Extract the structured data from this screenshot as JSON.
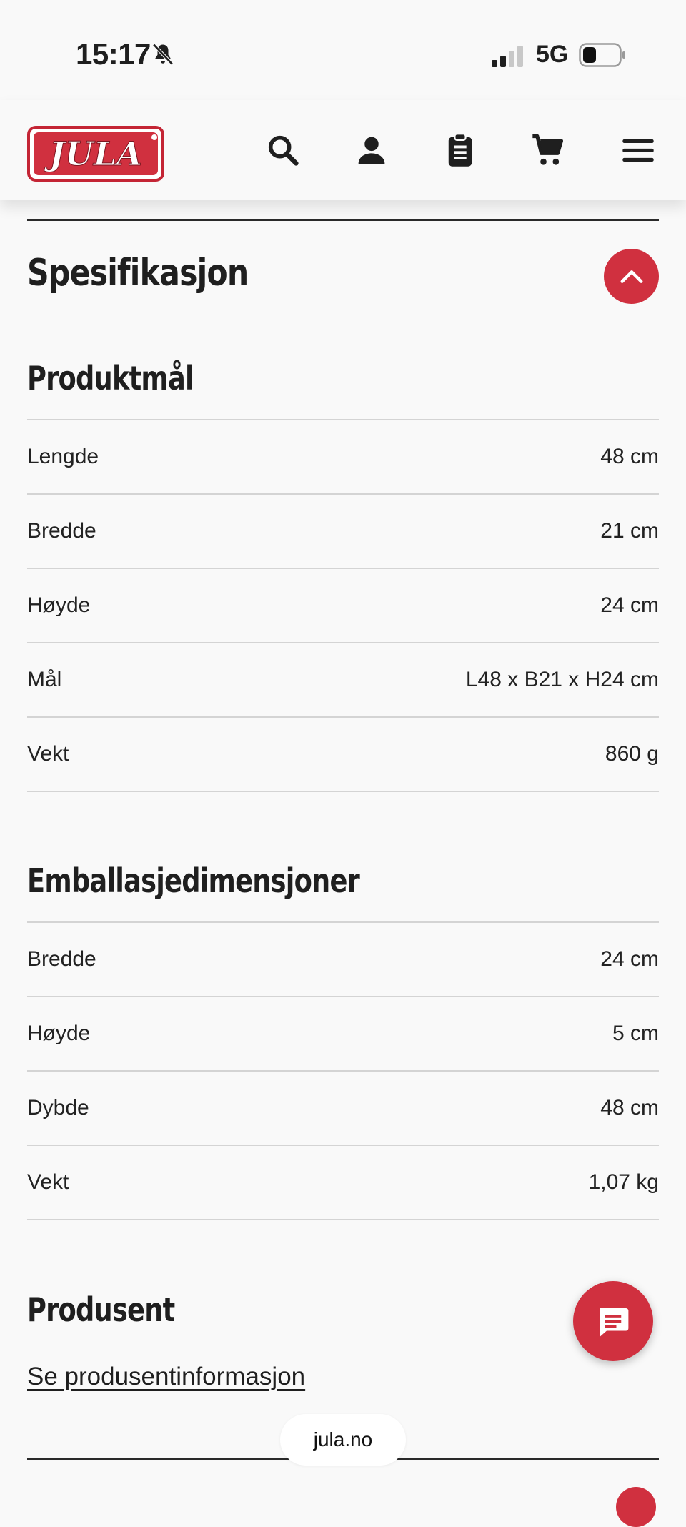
{
  "status_bar": {
    "time": "15:17",
    "network": "5G"
  },
  "header": {
    "logo_text": "JULA",
    "icons": [
      "search-icon",
      "account-icon",
      "clipboard-icon",
      "cart-icon",
      "menu-icon"
    ],
    "brand_color": "#d0303f"
  },
  "spec": {
    "title": "Spesifikasjon",
    "product_dimensions": {
      "title": "Produktmål",
      "rows": [
        {
          "label": "Lengde",
          "value": "48 cm"
        },
        {
          "label": "Bredde",
          "value": "21 cm"
        },
        {
          "label": "Høyde",
          "value": "24 cm"
        },
        {
          "label": "Mål",
          "value": "L48 x B21 x H24 cm"
        },
        {
          "label": "Vekt",
          "value": "860 g"
        }
      ]
    },
    "package_dimensions": {
      "title": "Emballasjedimensjoner",
      "rows": [
        {
          "label": "Bredde",
          "value": "24 cm"
        },
        {
          "label": "Høyde",
          "value": "5 cm"
        },
        {
          "label": "Dybde",
          "value": "48 cm"
        },
        {
          "label": "Vekt",
          "value": "1,07 kg"
        }
      ]
    },
    "manufacturer": {
      "title": "Produsent",
      "link_text": "Se produsentinformasjon"
    }
  },
  "browser": {
    "url": "jula.no"
  }
}
